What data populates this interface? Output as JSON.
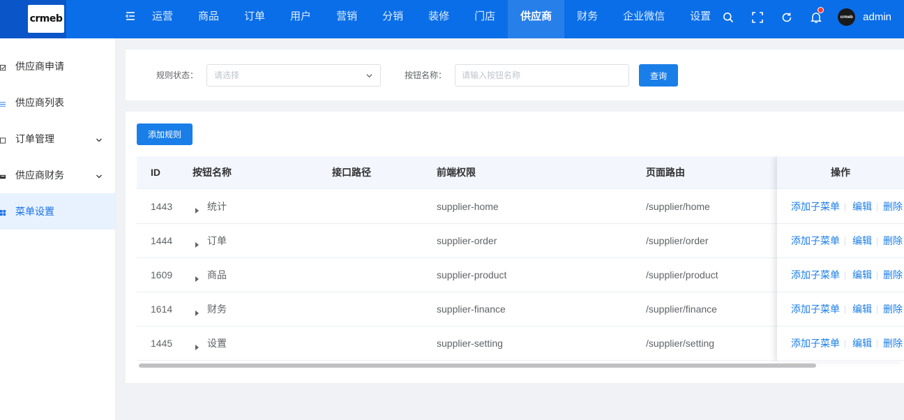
{
  "brand": {
    "logo_text": "crmeb"
  },
  "topnav": {
    "items": [
      "运营",
      "商品",
      "订单",
      "用户",
      "营销",
      "分销",
      "装修",
      "门店",
      "供应商",
      "财务",
      "企业微信",
      "设置"
    ],
    "active_index": 8
  },
  "header_tools": {
    "avatar_text": "crmeb",
    "username": "admin",
    "icons": [
      "search-icon",
      "fullscreen-icon",
      "refresh-icon",
      "bell-icon"
    ]
  },
  "sidebar": {
    "items": [
      {
        "label": "供应商申请",
        "icon": "checkbox-icon",
        "has_arrow": false
      },
      {
        "label": "供应商列表",
        "icon": "list-icon",
        "has_arrow": false
      },
      {
        "label": "订单管理",
        "icon": "document-icon",
        "has_arrow": true
      },
      {
        "label": "供应商财务",
        "icon": "wallet-icon",
        "has_arrow": true
      },
      {
        "label": "菜单设置",
        "icon": "grid-icon",
        "has_arrow": false
      }
    ],
    "active_index": 4
  },
  "filters": {
    "status_label": "规则状态：",
    "status_placeholder": "请选择",
    "name_label": "按钮名称：",
    "name_placeholder": "请输入按钮名称",
    "query_button": "查询"
  },
  "toolbar": {
    "add_button": "添加规则"
  },
  "table": {
    "headers": [
      "ID",
      "按钮名称",
      "接口路径",
      "前端权限",
      "页面路由",
      "操作"
    ],
    "rows": [
      {
        "id": "1443",
        "name": "统计",
        "api": "",
        "perm": "supplier-home",
        "route": "/supplier/home"
      },
      {
        "id": "1444",
        "name": "订单",
        "api": "",
        "perm": "supplier-order",
        "route": "/supplier/order"
      },
      {
        "id": "1609",
        "name": "商品",
        "api": "",
        "perm": "supplier-product",
        "route": "/supplier/product"
      },
      {
        "id": "1614",
        "name": "财务",
        "api": "",
        "perm": "supplier-finance",
        "route": "/supplier/finance"
      },
      {
        "id": "1445",
        "name": "设置",
        "api": "",
        "perm": "supplier-setting",
        "route": "/supplier/setting"
      }
    ],
    "actions": [
      "添加子菜单",
      "编辑",
      "删除"
    ]
  },
  "colors": {
    "primary": "#1a7ee8",
    "topbar": "#0a6ee8",
    "active_bg": "#e8f1fe",
    "notify": "#ff3b30"
  }
}
